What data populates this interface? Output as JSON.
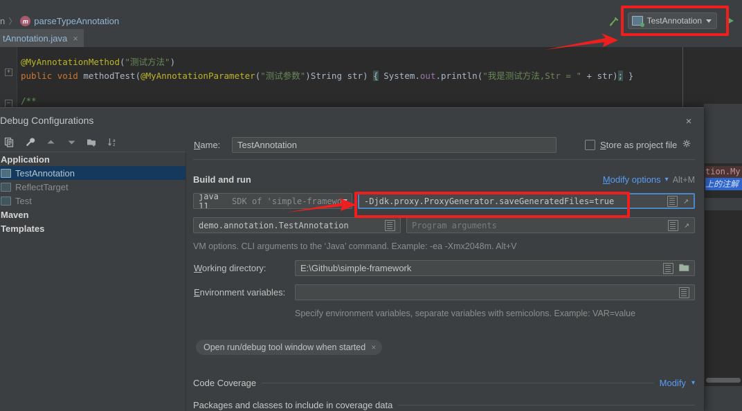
{
  "ide": {
    "breadcrumb": {
      "prefix": "n",
      "separator": "〉",
      "method_icon": "m",
      "method": "parseTypeAnnotation"
    },
    "run_config": {
      "name": "TestAnnotation",
      "icon": "application-icon",
      "dropdown_icon": "chevron-down-icon"
    },
    "nav_icons": {
      "build": "hammer-icon",
      "run": "run-triangle-icon"
    },
    "tab": {
      "title": "tAnnotation.java",
      "close": "×"
    },
    "code": {
      "line1_annotation": "@MyAnnotationMethod",
      "line1_paren_open": "(",
      "line1_string": "\"测试方法\"",
      "line1_paren_close": ")",
      "line2_kw1": "public",
      "line2_kw2": "void",
      "line2_method": "methodTest",
      "line2_p1": "(",
      "line2_ann": "@MyAnnotationParameter",
      "line2_p2": "(",
      "line2_str1": "\"测试参数\"",
      "line2_p3": ")",
      "line2_type": "String str",
      "line2_p4": ")",
      "line2_brace_open": "{",
      "line2_sys": "System.",
      "line2_out": "out",
      "line2_dot": ".",
      "line2_println": "println",
      "line2_p5": "(",
      "line2_str2": "\"我是测试方法,Str = \"",
      "line2_plus": " + ",
      "line2_str_var": "str",
      "line2_p6": ")",
      "line2_semi": ";",
      "line2_brace_close": "}",
      "line3_comment": "/**"
    },
    "background_popup": {
      "line1": "tion.My",
      "line2": "上的注解"
    }
  },
  "dialog": {
    "title": "Debug Configurations",
    "close_icon": "×",
    "toolbar": [
      {
        "name": "copy-configuration-button",
        "icon": "copy-icon"
      },
      {
        "name": "edit-templates-button",
        "icon": "wrench-icon"
      },
      {
        "name": "move-up-button",
        "icon": "arrow-up-icon"
      },
      {
        "name": "move-down-button",
        "icon": "arrow-down-icon"
      },
      {
        "name": "new-folder-button",
        "icon": "folder-add-icon"
      },
      {
        "name": "sort-configurations-button",
        "icon": "sort-az-icon"
      }
    ],
    "tree": [
      {
        "type": "group",
        "label": "Application"
      },
      {
        "type": "item",
        "label": "TestAnnotation",
        "selected": true,
        "dim": false
      },
      {
        "type": "item",
        "label": "ReflectTarget",
        "selected": false,
        "dim": true
      },
      {
        "type": "item",
        "label": "Test",
        "selected": false,
        "dim": true
      },
      {
        "type": "group",
        "label": "Maven"
      },
      {
        "type": "group",
        "label": "Templates"
      }
    ],
    "form": {
      "name_label": "Name:",
      "name_label_mnemonic": "N",
      "name_value": "TestAnnotation",
      "store_as_project_file": "Store as project file",
      "store_as_project_file_mnemonic": "S",
      "store_checked": false,
      "settings_gear_icon": "gear-icon",
      "build_and_run": "Build and run",
      "modify_options": "Modify options",
      "modify_options_mnemonic": "M",
      "modify_options_shortcut": "Alt+M",
      "sdk_main": "java 11",
      "sdk_sub": "SDK of 'simple-framewo",
      "vm_options_value": "-Djdk.proxy.ProxyGenerator.saveGeneratedFiles=true",
      "main_class_value": "demo.annotation.TestAnnotation",
      "program_arguments_placeholder": "Program arguments",
      "vm_hint": "VM options. CLI arguments to the ‘Java’ command. Example: -ea -Xmx2048m. Alt+V",
      "working_directory_label": "Working directory:",
      "working_directory_mnemonic": "W",
      "working_directory_value": "E:\\Github\\simple-framework",
      "environment_variables_label": "Environment variables:",
      "environment_variables_mnemonic": "E",
      "environment_variables_value": "",
      "env_hint": "Specify environment variables, separate variables with semicolons. Example: VAR=value",
      "chip_label": "Open run/debug tool window when started",
      "chip_close": "×",
      "code_coverage": "Code Coverage",
      "code_coverage_modify": "Modify",
      "coverage_packages": "Packages and classes to include in coverage data"
    }
  },
  "annotations": {
    "highlight_color": "#f01f1f",
    "boxes": [
      "run-configuration-selector",
      "vm-options-field"
    ],
    "arrows": [
      "arrow-to-run-configuration",
      "arrow-to-vm-options"
    ]
  }
}
